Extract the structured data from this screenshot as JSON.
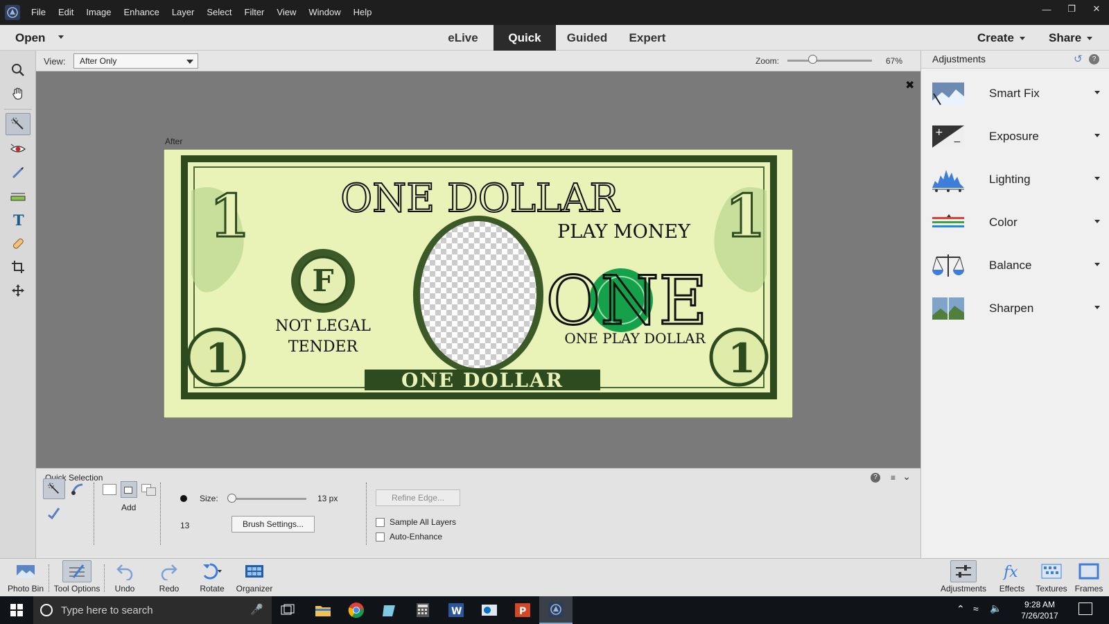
{
  "menubar": {
    "items": [
      "File",
      "Edit",
      "Image",
      "Enhance",
      "Layer",
      "Select",
      "Filter",
      "View",
      "Window",
      "Help"
    ]
  },
  "modebar": {
    "open_label": "Open",
    "tabs": [
      "eLive",
      "Quick",
      "Guided",
      "Expert"
    ],
    "active_tab": "Quick",
    "create_label": "Create",
    "share_label": "Share"
  },
  "viewbar": {
    "view_label": "View:",
    "view_value": "After Only",
    "zoom_label": "Zoom:",
    "zoom_value": "67%",
    "zoom_fraction": 0.67
  },
  "canvas": {
    "after_label": "After",
    "bill": {
      "title": "ONE DOLLAR",
      "play_money": "PLAY MONEY",
      "seal_letter": "F",
      "not_legal": "NOT LEGAL",
      "tender": "TENDER",
      "one_big": "ONE",
      "one_play_dollar": "ONE PLAY DOLLAR",
      "bottom_text": "ONE DOLLAR",
      "corner_numeral": "1"
    }
  },
  "tooloptions": {
    "title": "Quick Selection",
    "add_label": "Add",
    "size_label": "Size:",
    "size_value": "13 px",
    "brush_num": "13",
    "brush_settings_label": "Brush Settings...",
    "refine_edge_label": "Refine Edge...",
    "sample_all_layers_label": "Sample All Layers",
    "auto_enhance_label": "Auto-Enhance"
  },
  "rightpanel": {
    "title": "Adjustments",
    "items": [
      {
        "label": "Smart Fix"
      },
      {
        "label": "Exposure"
      },
      {
        "label": "Lighting"
      },
      {
        "label": "Color"
      },
      {
        "label": "Balance"
      },
      {
        "label": "Sharpen"
      }
    ]
  },
  "bottombar": {
    "left": [
      {
        "label": "Photo Bin"
      },
      {
        "label": "Tool Options"
      },
      {
        "label": "Undo"
      },
      {
        "label": "Redo"
      },
      {
        "label": "Rotate"
      },
      {
        "label": "Organizer"
      }
    ],
    "right": [
      {
        "label": "Adjustments"
      },
      {
        "label": "Effects"
      },
      {
        "label": "Textures"
      },
      {
        "label": "Frames"
      }
    ]
  },
  "taskbar": {
    "search_placeholder": "Type here to search",
    "time": "9:28 AM",
    "date": "7/26/2017"
  },
  "colors": {
    "bill_bg": "#e9f3b8",
    "bill_ink": "#2e4a1f",
    "menu_bg": "#1e1e1e",
    "canvas_bg": "#7a7a7a"
  }
}
